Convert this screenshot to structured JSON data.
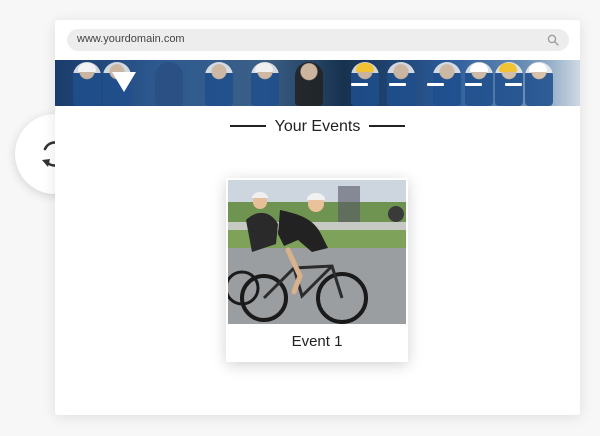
{
  "browser": {
    "url": "www.yourdomain.com",
    "search_icon": "search-icon"
  },
  "banner": {
    "image": "cyclists-peloton-banner",
    "menu_icon": "dropdown-triangle-icon"
  },
  "section": {
    "title": "Your Events"
  },
  "events": [
    {
      "label": "Event 1",
      "image": "road-cyclists-photo"
    }
  ],
  "sync": {
    "icon": "sync-icon"
  },
  "colors": {
    "text": "#222222",
    "address_bar": "#ededed",
    "background": "#f7f7f7"
  }
}
